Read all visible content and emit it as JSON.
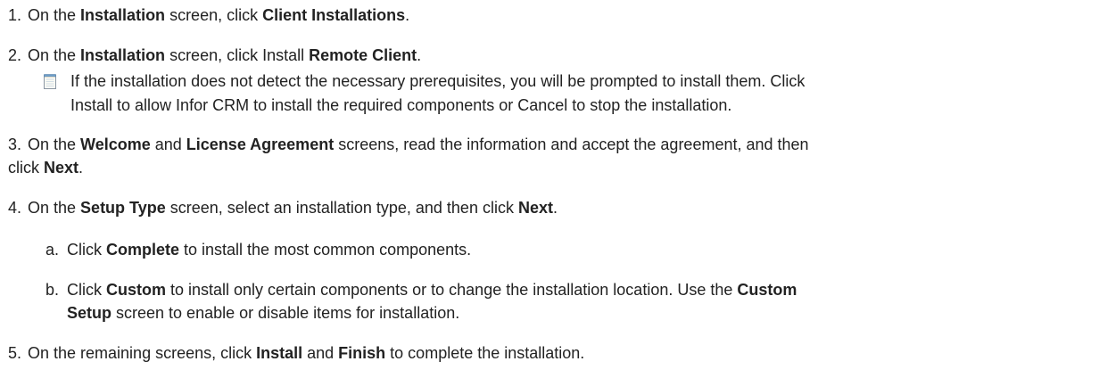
{
  "steps": [
    {
      "num": "1.",
      "t1": "On the ",
      "b1": "Installation",
      "t2": " screen, click ",
      "b2": "Client Installations",
      "t3": "."
    },
    {
      "num": "2.",
      "t1": "On the ",
      "b1": "Installation",
      "t2": " screen, click Install ",
      "b2": "Remote Client",
      "t3": ".",
      "note": {
        "icon": "note-icon",
        "line1": "If the installation does not detect the necessary prerequisites, you will be prompted to install them. Click",
        "line2": "Install to allow Infor CRM to install the required components or Cancel to stop the installation."
      }
    },
    {
      "num": "3.",
      "t1": "On the ",
      "b1": "Welcome",
      "t2": " and ",
      "b2": "License Agreement",
      "t3": " screens, read the information and accept the agreement, and then",
      "l2t1": "click ",
      "l2b1": "Next",
      "l2t2": "."
    },
    {
      "num": "4.",
      "t1": "On the ",
      "b1": "Setup Type",
      "t2": " screen, select an installation type, and then click ",
      "b2": "Next",
      "t3": ".",
      "substeps": [
        {
          "num": "a.",
          "t1": "Click ",
          "b1": "Complete",
          "t2": " to install the most common components."
        },
        {
          "num": "b.",
          "t1": "Click ",
          "b1": "Custom",
          "t2": " to install only certain components or to change the installation location. Use the ",
          "b2": "Custom",
          "l2b1": "Setup",
          "l2t1": " screen to enable or disable items for installation."
        }
      ]
    },
    {
      "num": "5.",
      "t1": "On the remaining screens, click ",
      "b1": "Install",
      "t2": " and ",
      "b2": "Finish",
      "t3": " to complete the installation."
    }
  ]
}
